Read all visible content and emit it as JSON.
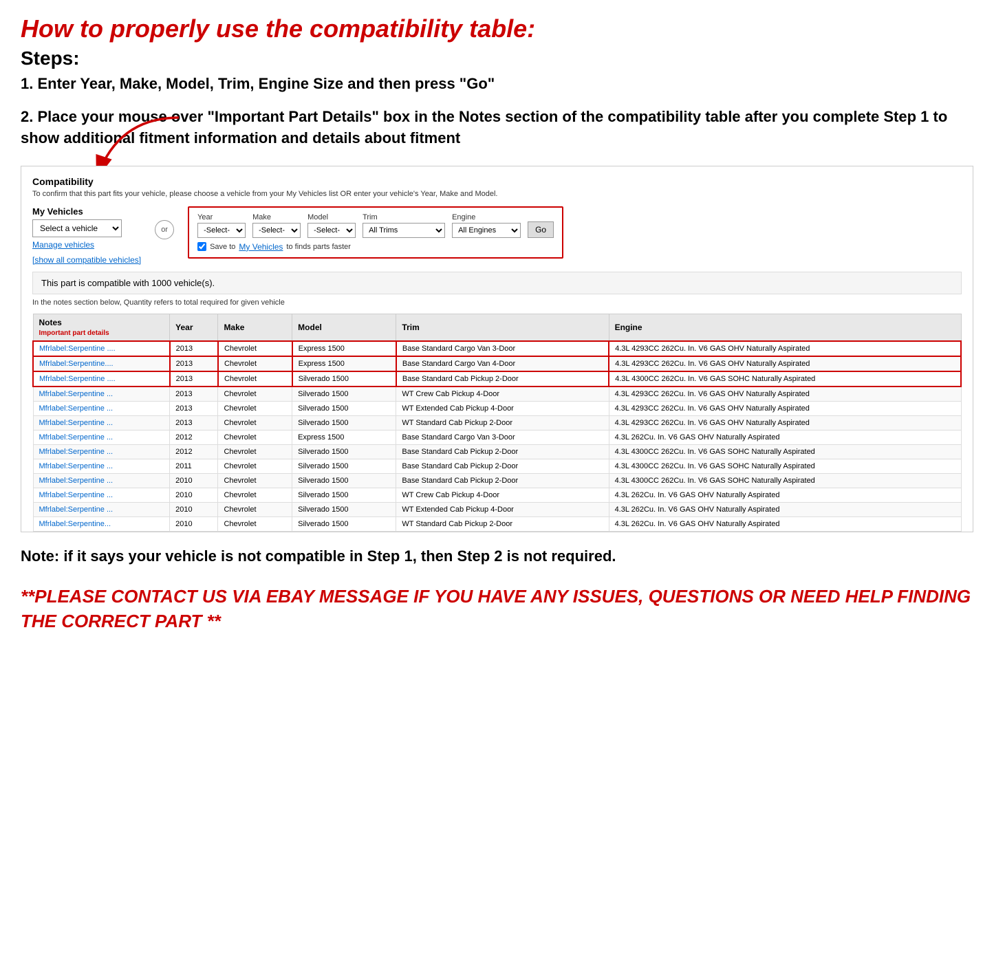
{
  "page": {
    "main_title": "How to properly use the compatibility table:",
    "steps_label": "Steps:",
    "step1": "1. Enter Year, Make, Model, Trim, Engine Size and then press \"Go\"",
    "step2": "2. Place your mouse over \"Important Part Details\" box in the Notes section of the compatibility table after you complete Step 1 to show additional fitment information and details about fitment",
    "note_text": "Note: if it says your vehicle is not compatible in Step 1, then Step 2 is not required.",
    "contact_text": "**PLEASE CONTACT US VIA EBAY MESSAGE IF YOU HAVE ANY ISSUES, QUESTIONS OR NEED HELP FINDING THE CORRECT PART **"
  },
  "compatibility_section": {
    "title": "Compatibility",
    "subtitle": "To confirm that this part fits your vehicle, please choose a vehicle from your My Vehicles list OR enter your vehicle's Year, Make and Model.",
    "my_vehicles_label": "My Vehicles",
    "select_vehicle_placeholder": "Select a vehicle",
    "manage_vehicles": "Manage vehicles",
    "show_all_link": "[show all compatible vehicles]",
    "or_label": "or",
    "year_label": "Year",
    "year_value": "-Select-",
    "make_label": "Make",
    "make_value": "-Select-",
    "model_label": "Model",
    "model_value": "-Select-",
    "trim_label": "Trim",
    "trim_value": "All Trims",
    "engine_label": "Engine",
    "engine_value": "All Engines",
    "go_button": "Go",
    "save_checkbox_text": "Save to",
    "save_link_text": "My Vehicles",
    "save_rest": "to finds parts faster",
    "compatible_note": "This part is compatible with 1000 vehicle(s).",
    "quantity_note": "In the notes section below, Quantity refers to total required for given vehicle"
  },
  "table": {
    "headers": [
      "Notes",
      "Year",
      "Make",
      "Model",
      "Trim",
      "Engine"
    ],
    "notes_sub": "Important part details",
    "rows": [
      {
        "notes": "Mfrlabel:Serpentine ....",
        "year": "2013",
        "make": "Chevrolet",
        "model": "Express 1500",
        "trim": "Base Standard Cargo Van 3-Door",
        "engine": "4.3L 4293CC 262Cu. In. V6 GAS OHV Naturally Aspirated",
        "highlight": true
      },
      {
        "notes": "Mfrlabel:Serpentine....",
        "year": "2013",
        "make": "Chevrolet",
        "model": "Express 1500",
        "trim": "Base Standard Cargo Van 4-Door",
        "engine": "4.3L 4293CC 262Cu. In. V6 GAS OHV Naturally Aspirated",
        "highlight": true
      },
      {
        "notes": "Mfrlabel:Serpentine ....",
        "year": "2013",
        "make": "Chevrolet",
        "model": "Silverado 1500",
        "trim": "Base Standard Cab Pickup 2-Door",
        "engine": "4.3L 4300CC 262Cu. In. V6 GAS SOHC Naturally Aspirated",
        "highlight": true
      },
      {
        "notes": "Mfrlabel:Serpentine ...",
        "year": "2013",
        "make": "Chevrolet",
        "model": "Silverado 1500",
        "trim": "WT Crew Cab Pickup 4-Door",
        "engine": "4.3L 4293CC 262Cu. In. V6 GAS OHV Naturally Aspirated",
        "highlight": false
      },
      {
        "notes": "Mfrlabel:Serpentine ...",
        "year": "2013",
        "make": "Chevrolet",
        "model": "Silverado 1500",
        "trim": "WT Extended Cab Pickup 4-Door",
        "engine": "4.3L 4293CC 262Cu. In. V6 GAS OHV Naturally Aspirated",
        "highlight": false
      },
      {
        "notes": "Mfrlabel:Serpentine ...",
        "year": "2013",
        "make": "Chevrolet",
        "model": "Silverado 1500",
        "trim": "WT Standard Cab Pickup 2-Door",
        "engine": "4.3L 4293CC 262Cu. In. V6 GAS OHV Naturally Aspirated",
        "highlight": false
      },
      {
        "notes": "Mfrlabel:Serpentine ...",
        "year": "2012",
        "make": "Chevrolet",
        "model": "Express 1500",
        "trim": "Base Standard Cargo Van 3-Door",
        "engine": "4.3L 262Cu. In. V6 GAS OHV Naturally Aspirated",
        "highlight": false
      },
      {
        "notes": "Mfrlabel:Serpentine ...",
        "year": "2012",
        "make": "Chevrolet",
        "model": "Silverado 1500",
        "trim": "Base Standard Cab Pickup 2-Door",
        "engine": "4.3L 4300CC 262Cu. In. V6 GAS SOHC Naturally Aspirated",
        "highlight": false
      },
      {
        "notes": "Mfrlabel:Serpentine ...",
        "year": "2011",
        "make": "Chevrolet",
        "model": "Silverado 1500",
        "trim": "Base Standard Cab Pickup 2-Door",
        "engine": "4.3L 4300CC 262Cu. In. V6 GAS SOHC Naturally Aspirated",
        "highlight": false
      },
      {
        "notes": "Mfrlabel:Serpentine ...",
        "year": "2010",
        "make": "Chevrolet",
        "model": "Silverado 1500",
        "trim": "Base Standard Cab Pickup 2-Door",
        "engine": "4.3L 4300CC 262Cu. In. V6 GAS SOHC Naturally Aspirated",
        "highlight": false
      },
      {
        "notes": "Mfrlabel:Serpentine ...",
        "year": "2010",
        "make": "Chevrolet",
        "model": "Silverado 1500",
        "trim": "WT Crew Cab Pickup 4-Door",
        "engine": "4.3L 262Cu. In. V6 GAS OHV Naturally Aspirated",
        "highlight": false
      },
      {
        "notes": "Mfrlabel:Serpentine ...",
        "year": "2010",
        "make": "Chevrolet",
        "model": "Silverado 1500",
        "trim": "WT Extended Cab Pickup 4-Door",
        "engine": "4.3L 262Cu. In. V6 GAS OHV Naturally Aspirated",
        "highlight": false
      },
      {
        "notes": "Mfrlabel:Serpentine...",
        "year": "2010",
        "make": "Chevrolet",
        "model": "Silverado 1500",
        "trim": "WT Standard Cab Pickup 2-Door",
        "engine": "4.3L 262Cu. In. V6 GAS OHV Naturally Aspirated",
        "highlight": false
      }
    ]
  },
  "colors": {
    "red": "#cc0000",
    "blue_link": "#0066cc",
    "table_border_highlight": "#cc0000"
  }
}
